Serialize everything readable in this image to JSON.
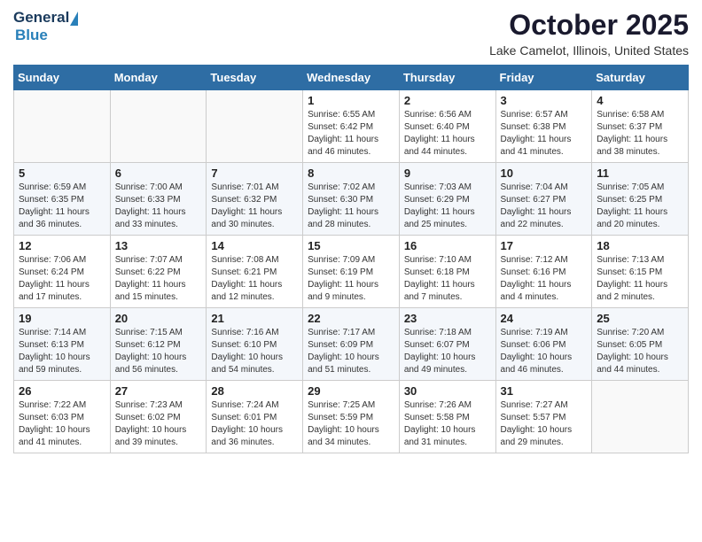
{
  "header": {
    "logo_general": "General",
    "logo_blue": "Blue",
    "month_title": "October 2025",
    "location": "Lake Camelot, Illinois, United States"
  },
  "calendar": {
    "weekdays": [
      "Sunday",
      "Monday",
      "Tuesday",
      "Wednesday",
      "Thursday",
      "Friday",
      "Saturday"
    ],
    "weeks": [
      [
        {
          "day": "",
          "info": ""
        },
        {
          "day": "",
          "info": ""
        },
        {
          "day": "",
          "info": ""
        },
        {
          "day": "1",
          "info": "Sunrise: 6:55 AM\nSunset: 6:42 PM\nDaylight: 11 hours\nand 46 minutes."
        },
        {
          "day": "2",
          "info": "Sunrise: 6:56 AM\nSunset: 6:40 PM\nDaylight: 11 hours\nand 44 minutes."
        },
        {
          "day": "3",
          "info": "Sunrise: 6:57 AM\nSunset: 6:38 PM\nDaylight: 11 hours\nand 41 minutes."
        },
        {
          "day": "4",
          "info": "Sunrise: 6:58 AM\nSunset: 6:37 PM\nDaylight: 11 hours\nand 38 minutes."
        }
      ],
      [
        {
          "day": "5",
          "info": "Sunrise: 6:59 AM\nSunset: 6:35 PM\nDaylight: 11 hours\nand 36 minutes."
        },
        {
          "day": "6",
          "info": "Sunrise: 7:00 AM\nSunset: 6:33 PM\nDaylight: 11 hours\nand 33 minutes."
        },
        {
          "day": "7",
          "info": "Sunrise: 7:01 AM\nSunset: 6:32 PM\nDaylight: 11 hours\nand 30 minutes."
        },
        {
          "day": "8",
          "info": "Sunrise: 7:02 AM\nSunset: 6:30 PM\nDaylight: 11 hours\nand 28 minutes."
        },
        {
          "day": "9",
          "info": "Sunrise: 7:03 AM\nSunset: 6:29 PM\nDaylight: 11 hours\nand 25 minutes."
        },
        {
          "day": "10",
          "info": "Sunrise: 7:04 AM\nSunset: 6:27 PM\nDaylight: 11 hours\nand 22 minutes."
        },
        {
          "day": "11",
          "info": "Sunrise: 7:05 AM\nSunset: 6:25 PM\nDaylight: 11 hours\nand 20 minutes."
        }
      ],
      [
        {
          "day": "12",
          "info": "Sunrise: 7:06 AM\nSunset: 6:24 PM\nDaylight: 11 hours\nand 17 minutes."
        },
        {
          "day": "13",
          "info": "Sunrise: 7:07 AM\nSunset: 6:22 PM\nDaylight: 11 hours\nand 15 minutes."
        },
        {
          "day": "14",
          "info": "Sunrise: 7:08 AM\nSunset: 6:21 PM\nDaylight: 11 hours\nand 12 minutes."
        },
        {
          "day": "15",
          "info": "Sunrise: 7:09 AM\nSunset: 6:19 PM\nDaylight: 11 hours\nand 9 minutes."
        },
        {
          "day": "16",
          "info": "Sunrise: 7:10 AM\nSunset: 6:18 PM\nDaylight: 11 hours\nand 7 minutes."
        },
        {
          "day": "17",
          "info": "Sunrise: 7:12 AM\nSunset: 6:16 PM\nDaylight: 11 hours\nand 4 minutes."
        },
        {
          "day": "18",
          "info": "Sunrise: 7:13 AM\nSunset: 6:15 PM\nDaylight: 11 hours\nand 2 minutes."
        }
      ],
      [
        {
          "day": "19",
          "info": "Sunrise: 7:14 AM\nSunset: 6:13 PM\nDaylight: 10 hours\nand 59 minutes."
        },
        {
          "day": "20",
          "info": "Sunrise: 7:15 AM\nSunset: 6:12 PM\nDaylight: 10 hours\nand 56 minutes."
        },
        {
          "day": "21",
          "info": "Sunrise: 7:16 AM\nSunset: 6:10 PM\nDaylight: 10 hours\nand 54 minutes."
        },
        {
          "day": "22",
          "info": "Sunrise: 7:17 AM\nSunset: 6:09 PM\nDaylight: 10 hours\nand 51 minutes."
        },
        {
          "day": "23",
          "info": "Sunrise: 7:18 AM\nSunset: 6:07 PM\nDaylight: 10 hours\nand 49 minutes."
        },
        {
          "day": "24",
          "info": "Sunrise: 7:19 AM\nSunset: 6:06 PM\nDaylight: 10 hours\nand 46 minutes."
        },
        {
          "day": "25",
          "info": "Sunrise: 7:20 AM\nSunset: 6:05 PM\nDaylight: 10 hours\nand 44 minutes."
        }
      ],
      [
        {
          "day": "26",
          "info": "Sunrise: 7:22 AM\nSunset: 6:03 PM\nDaylight: 10 hours\nand 41 minutes."
        },
        {
          "day": "27",
          "info": "Sunrise: 7:23 AM\nSunset: 6:02 PM\nDaylight: 10 hours\nand 39 minutes."
        },
        {
          "day": "28",
          "info": "Sunrise: 7:24 AM\nSunset: 6:01 PM\nDaylight: 10 hours\nand 36 minutes."
        },
        {
          "day": "29",
          "info": "Sunrise: 7:25 AM\nSunset: 5:59 PM\nDaylight: 10 hours\nand 34 minutes."
        },
        {
          "day": "30",
          "info": "Sunrise: 7:26 AM\nSunset: 5:58 PM\nDaylight: 10 hours\nand 31 minutes."
        },
        {
          "day": "31",
          "info": "Sunrise: 7:27 AM\nSunset: 5:57 PM\nDaylight: 10 hours\nand 29 minutes."
        },
        {
          "day": "",
          "info": ""
        }
      ]
    ]
  }
}
